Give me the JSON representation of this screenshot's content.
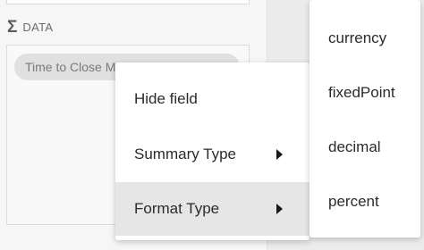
{
  "panel": {
    "section_icon": "sigma-icon",
    "section_label": "DATA",
    "field_chip": "Time to Close M"
  },
  "context_menu": {
    "items": [
      {
        "label": "Hide field",
        "has_submenu": false
      },
      {
        "label": "Summary Type",
        "has_submenu": true
      },
      {
        "label": "Format Type",
        "has_submenu": true,
        "selected": true
      }
    ]
  },
  "format_submenu": {
    "items": [
      {
        "label": "currency"
      },
      {
        "label": "fixedPoint"
      },
      {
        "label": "decimal"
      },
      {
        "label": "percent"
      }
    ]
  },
  "colors": {
    "selected_item_bg": "#e6e6e6",
    "chip_bg": "#e0e0e0",
    "panel_bg": "#f6f6f6"
  }
}
